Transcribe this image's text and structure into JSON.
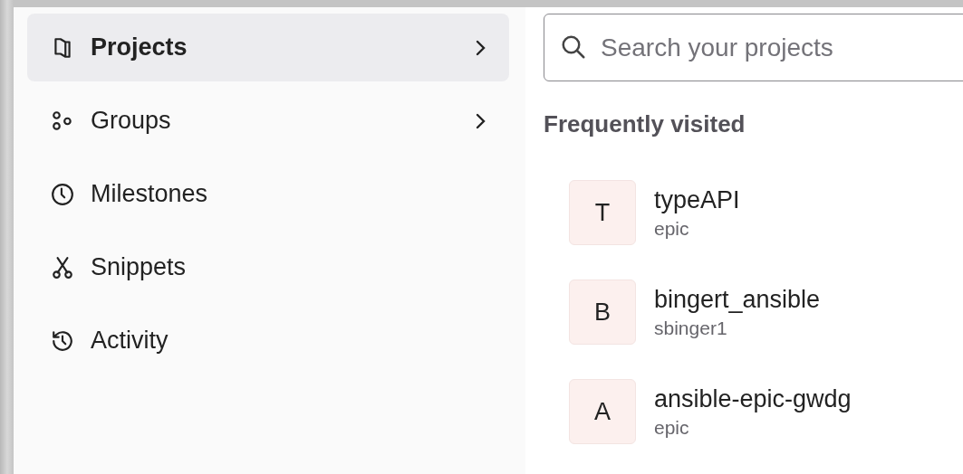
{
  "nav": {
    "items": [
      {
        "kind": "projects",
        "label": "Projects",
        "selected": true,
        "has_submenu": true
      },
      {
        "kind": "groups",
        "label": "Groups",
        "selected": false,
        "has_submenu": true
      },
      {
        "kind": "milestones",
        "label": "Milestones",
        "selected": false,
        "has_submenu": false
      },
      {
        "kind": "snippets",
        "label": "Snippets",
        "selected": false,
        "has_submenu": false
      },
      {
        "kind": "activity",
        "label": "Activity",
        "selected": false,
        "has_submenu": false
      }
    ]
  },
  "search": {
    "placeholder": "Search your projects"
  },
  "frequently_visited": {
    "title": "Frequently visited",
    "projects": [
      {
        "initial": "T",
        "name": "typeAPI",
        "namespace": "epic"
      },
      {
        "initial": "B",
        "name": "bingert_ansible",
        "namespace": "sbinger1"
      },
      {
        "initial": "A",
        "name": "ansible-epic-gwdg",
        "namespace": "epic"
      }
    ]
  }
}
